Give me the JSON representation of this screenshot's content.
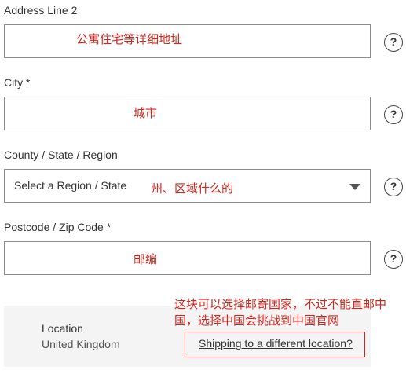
{
  "address2": {
    "label": "Address Line 2",
    "annotation": "公寓住宅等详细地址",
    "help": "?"
  },
  "city": {
    "label": "City *",
    "annotation": "城市",
    "help": "?"
  },
  "region": {
    "label": "County / State / Region",
    "selected": "Select a Region / State",
    "annotation": "州、区域什么的",
    "help": "?"
  },
  "postcode": {
    "label": "Postcode / Zip Code *",
    "annotation": "邮编",
    "help": "?"
  },
  "location": {
    "title": "Location",
    "value": "United Kingdom",
    "change_link": "Shipping to a different location?",
    "annotation": "这块可以选择邮寄国家，不过不能直邮中国，选择中国会挑战到中国官网"
  },
  "colors": {
    "annotation_red": "#d0251c",
    "panel_bg": "#f4f4f4",
    "border": "#8c8c8c"
  }
}
